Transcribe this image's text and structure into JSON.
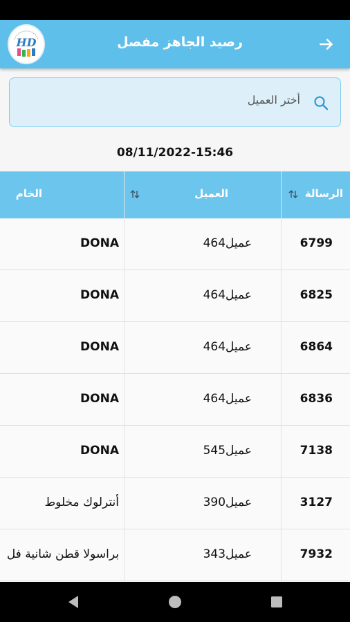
{
  "app": {
    "title": "رصيد الجاهز مفصل",
    "logo_text": "HD"
  },
  "search": {
    "placeholder": "أختر العميل"
  },
  "datetime": "08/11/2022-15:46",
  "table": {
    "headers": {
      "message": "الرسالة",
      "client": "العميل",
      "raw": "الخام"
    },
    "rows": [
      {
        "message": "6799",
        "client": "464عميل",
        "raw": "DONA"
      },
      {
        "message": "6825",
        "client": "464عميل",
        "raw": "DONA"
      },
      {
        "message": "6864",
        "client": "464عميل",
        "raw": "DONA"
      },
      {
        "message": "6836",
        "client": "464عميل",
        "raw": "DONA"
      },
      {
        "message": "7138",
        "client": "545عميل",
        "raw": "DONA"
      },
      {
        "message": "3127",
        "client": "390عميل",
        "raw": "أنترلوك مخلوط"
      },
      {
        "message": "7932",
        "client": "343عميل",
        "raw": "براسولا قطن شانية فل"
      }
    ]
  },
  "colors": {
    "accent": "#5ebfea",
    "header": "#6cc5ec",
    "search_bg": "#ddf0fa"
  }
}
